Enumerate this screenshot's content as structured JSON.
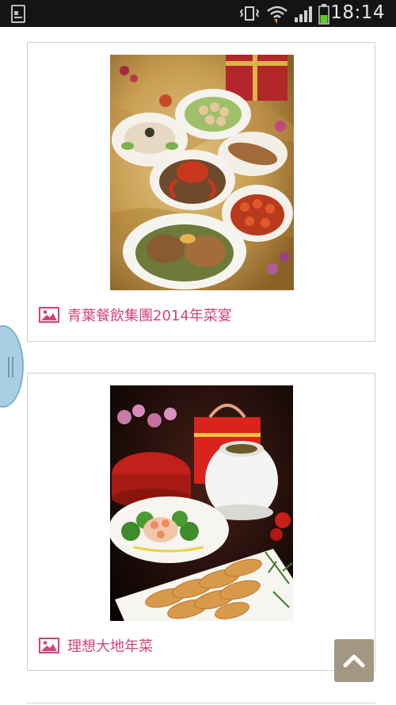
{
  "status_bar": {
    "time": "18:14",
    "icons": [
      "notification-icon",
      "vibrate-icon",
      "wifi-icon",
      "signal-icon",
      "battery-icon"
    ]
  },
  "feed": {
    "items": [
      {
        "caption": "青葉餐飲集團2014年菜宴",
        "icon": "image-icon"
      },
      {
        "caption": "理想大地年菜",
        "icon": "image-icon"
      }
    ]
  },
  "controls": {
    "scroll_top_icon": "chevron-up-icon",
    "side_handle_icon": "drawer-handle-icon"
  },
  "colors": {
    "caption": "#d0457c",
    "status_bar": "#141414",
    "scroll_top_button": "#a39683",
    "side_handle": "#a9cfe2"
  }
}
